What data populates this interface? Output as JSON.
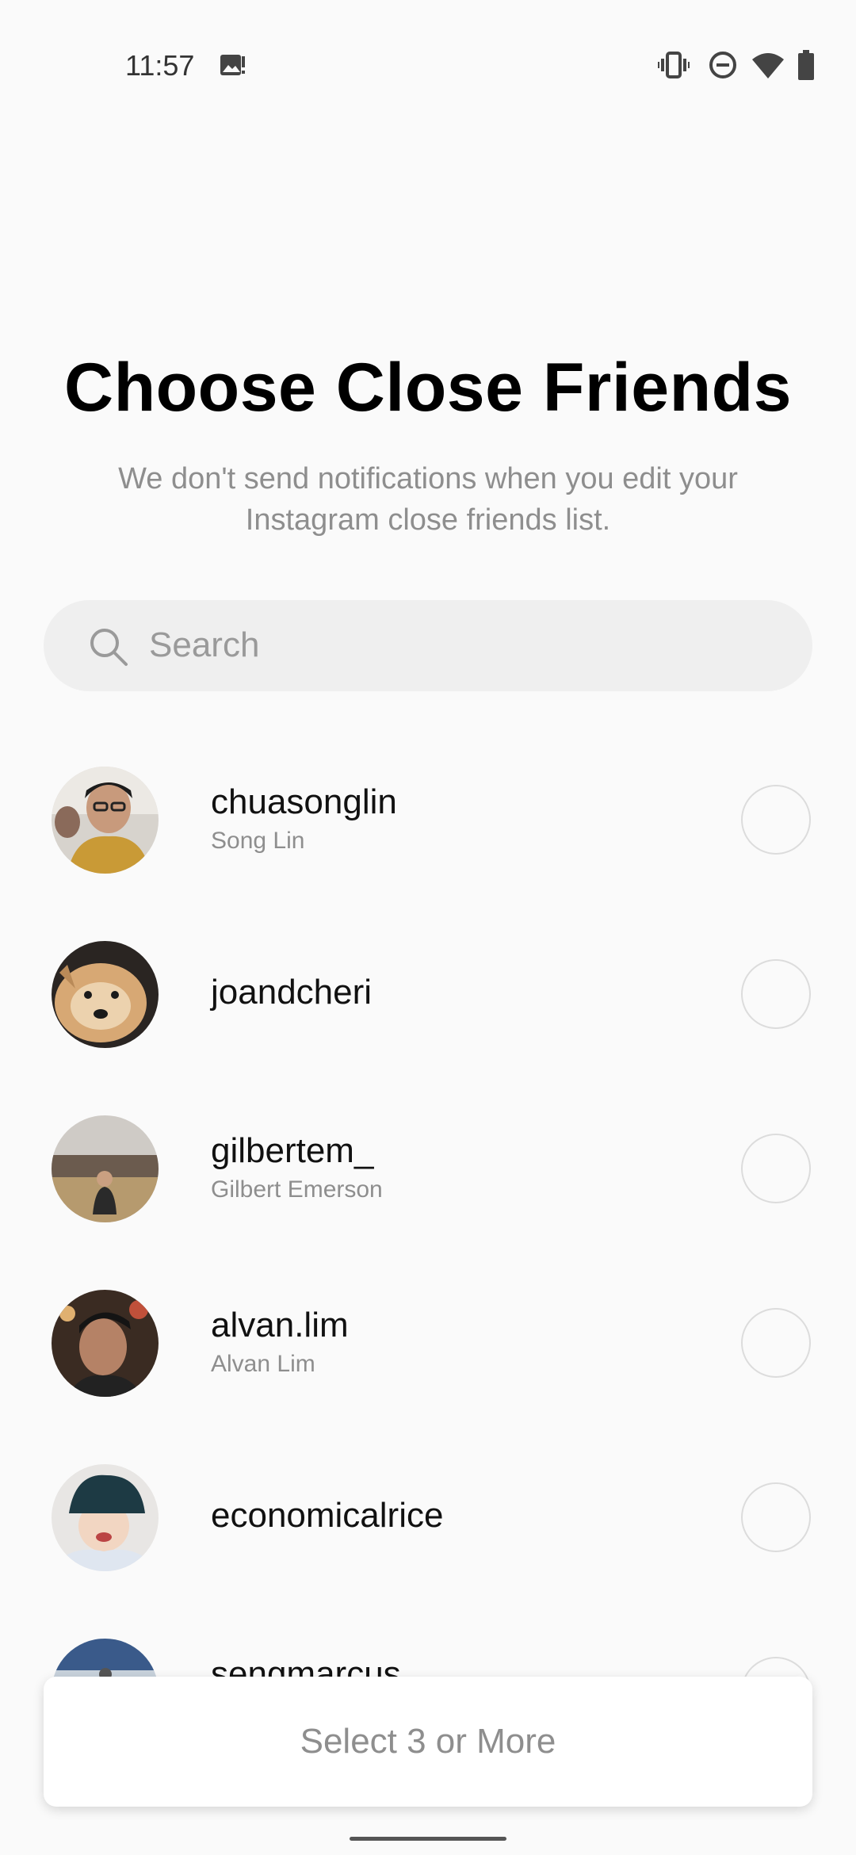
{
  "status_bar": {
    "time": "11:57",
    "icons": [
      "image-alert-icon",
      "vibrate-icon",
      "do-not-disturb-icon",
      "wifi-icon",
      "battery-icon"
    ]
  },
  "header": {
    "title": "Choose Close Friends",
    "subtitle": "We don't send notifications when you edit your Instagram close friends list."
  },
  "search": {
    "placeholder": "Search",
    "icon": "search-icon"
  },
  "friends": [
    {
      "username": "chuasonglin",
      "full_name": "Song Lin"
    },
    {
      "username": "joandcheri",
      "full_name": ""
    },
    {
      "username": "gilbertem_",
      "full_name": "Gilbert Emerson"
    },
    {
      "username": "alvan.lim",
      "full_name": "Alvan Lim"
    },
    {
      "username": "economicalrice",
      "full_name": ""
    },
    {
      "username": "sengmarcus",
      "full_name": ""
    }
  ],
  "footer": {
    "button_label": "Select 3 or More"
  },
  "colors": {
    "background": "#fafafa",
    "secondary_text": "#8e8e8e",
    "search_bg": "#efefef"
  }
}
